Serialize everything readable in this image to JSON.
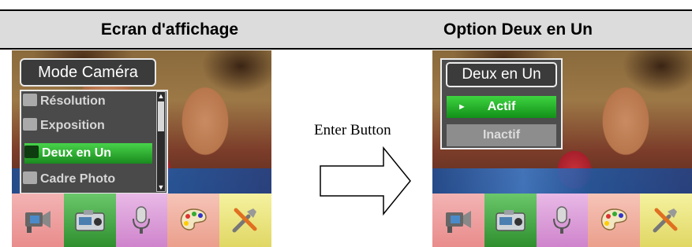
{
  "headers": {
    "left": "Ecran d'affichage",
    "right": "Option Deux en Un"
  },
  "left_screen": {
    "menu_title": "Mode Caméra",
    "menu_items": [
      {
        "label": "Résolution",
        "icon": "resolution-icon"
      },
      {
        "label": "Exposition",
        "icon": "exposure-icon"
      },
      {
        "label": "Deux en Un",
        "icon": "two-in-one-icon",
        "selected": true
      },
      {
        "label": "Cadre Photo",
        "icon": "photo-frame-icon"
      }
    ]
  },
  "right_screen": {
    "dialog_title": "Deux en Un",
    "options": [
      {
        "label": "Actif",
        "selected": true
      },
      {
        "label": "Inactif",
        "selected": false
      }
    ]
  },
  "mode_bar": [
    "video-camera-icon",
    "camera-icon",
    "microphone-icon",
    "palette-icon",
    "tools-icon"
  ],
  "center": {
    "label": "Enter Button"
  },
  "colors": {
    "selection_green": "#1a8a1e",
    "header_band": "#dcdcdc",
    "menu_bg": "#4a4a4a"
  }
}
